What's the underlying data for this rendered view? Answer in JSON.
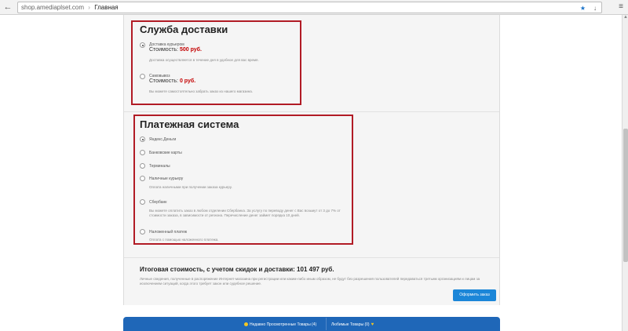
{
  "browser": {
    "url": "shop.amediaplset.com",
    "breadcrumb": "Главная",
    "back_glyph": "←",
    "star_glyph": "★",
    "menu_glyph": "≡"
  },
  "delivery": {
    "title": "Служба доставки",
    "options": [
      {
        "label": "Доставка курьером",
        "cost_label": "Стоимость:",
        "price": "500 руб.",
        "description": "Доставка осуществляется в течение дня в удобное для вас время.",
        "selected": true
      },
      {
        "label": "Самовывоз",
        "cost_label": "Стоимость:",
        "price": "0 руб.",
        "description": "Вы можете самостоятельно забрать заказ из нашего магазина.",
        "selected": false
      }
    ]
  },
  "payment": {
    "title": "Платежная система",
    "options": [
      {
        "label": "Яндекс.Деньги",
        "selected": true,
        "description": ""
      },
      {
        "label": "Банковские карты",
        "selected": false,
        "description": ""
      },
      {
        "label": "Терминалы",
        "selected": false,
        "description": ""
      },
      {
        "label": "Наличные курьеру",
        "selected": false,
        "description": "Оплата наличными при получении заказа курьеру."
      },
      {
        "label": "Сбербанк",
        "selected": false,
        "description": "Вы можете оплатить заказ в любом отделении Сбербанка. За услугу по переводу денег с Вас возьмут от 3 до 7% от стоимости заказа, в зависимости от региона. Перечисление денег займет порядка 10 дней."
      },
      {
        "label": "Наложенный платеж",
        "selected": false,
        "description": "Оплата с помощью наложенного платежа."
      }
    ]
  },
  "summary": {
    "total": "Итоговая стоимость, с учетом скидок и доставки: 101 497 руб.",
    "legal": "Личные сведения, полученные в распоряжение Интернет-магазина при регистрации или каким-либо иным образом, не будут без разрешения пользователей передаваться третьим организациям и лицам за исключением ситуаций, когда этого требует закон или судебное решение.",
    "checkout_label": "Оформить заказ"
  },
  "bottom_bar": {
    "recent": "Недавно Просмотренные Товары (4)",
    "favorites": "Любимые Товары (0)"
  },
  "colors": {
    "accent_border": "#b11b25",
    "price": "#c40000",
    "button": "#1b86d8",
    "bottom_bar": "#1f67b8"
  }
}
